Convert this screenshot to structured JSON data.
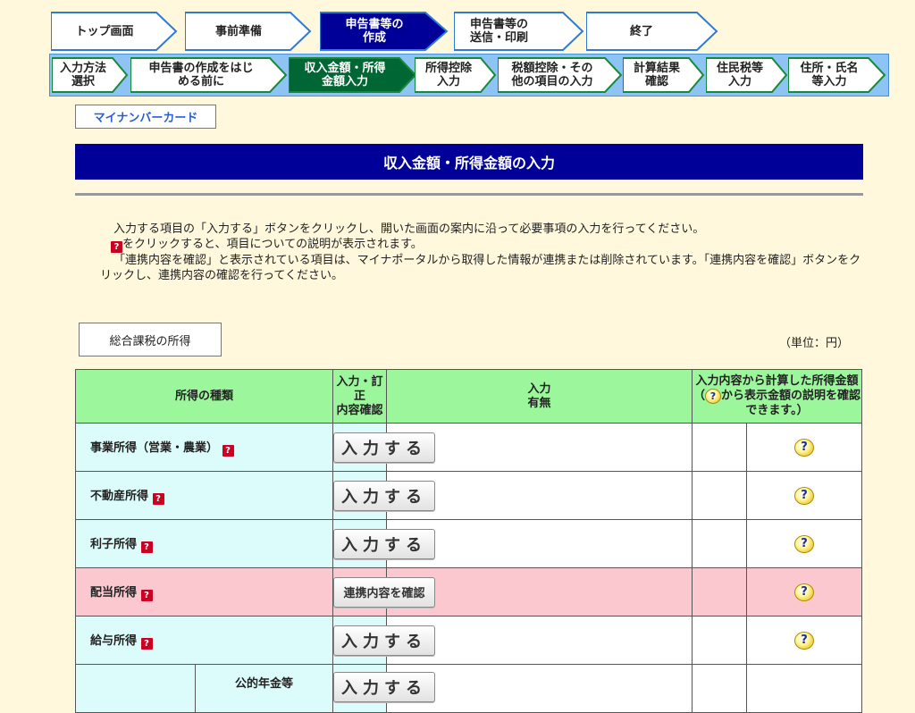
{
  "steps_top": [
    {
      "label": "トップ画面",
      "active": false
    },
    {
      "label": "事前準備",
      "active": false
    },
    {
      "label": "申告書等の\n作成",
      "active": true
    },
    {
      "label": "申告書等の\n送信・印刷",
      "active": false
    },
    {
      "label": "終了",
      "active": false
    }
  ],
  "steps_sub": [
    {
      "label": "入力方法\n選択",
      "active": false
    },
    {
      "label": "申告書の作成をはじ\nめる前に",
      "active": false
    },
    {
      "label": "収入金額・所得\n金額入力",
      "active": true
    },
    {
      "label": "所得控除\n入力",
      "active": false
    },
    {
      "label": "税額控除・その\n他の項目の入力",
      "active": false
    },
    {
      "label": "計算結果\n確認",
      "active": false
    },
    {
      "label": "住民税等\n入力",
      "active": false
    },
    {
      "label": "住所・氏名\n等入力",
      "active": false
    }
  ],
  "mynumber_tab": "マイナンバーカード",
  "page_title": "収入金額・所得金額の入力",
  "instructions": {
    "line1": "入力する項目の「入力する」ボタンをクリックし、開いた画面の案内に沿って必要事項の入力を行ってください。",
    "qmark_symbol": "?",
    "line2": "をクリックすると、項目についての説明が表示されます。",
    "line3": "「連携内容を確認」と表示されている項目は、マイナポータルから取得した情報が連携または削除されています。「連携内容を確認」ボタンをクリックし、連携内容の確認を行ってください。"
  },
  "section_tab": "総合課税の所得",
  "unit_label": "（単位：円）",
  "table": {
    "headers": {
      "type": "所得の種類",
      "input": "入力・訂正\n内容確認",
      "has": "入力\n有無",
      "amount_line1": "入力内容から計算した所得金額",
      "amount_line2_pre": "（",
      "amount_line2_post": "から表示金額の説明を確認できます。）"
    },
    "rows": [
      {
        "name": "事業所得（営業・農業）",
        "button": "入力する",
        "pink": false
      },
      {
        "name": "不動産所得",
        "button": "入力する",
        "pink": false
      },
      {
        "name": "利子所得",
        "button": "入力する",
        "pink": false
      },
      {
        "name": "配当所得",
        "button": "連携内容を確認",
        "pink": true
      },
      {
        "name": "給与所得",
        "button": "入力する",
        "pink": false
      }
    ],
    "partial_row": {
      "sub_name": "公的年金等",
      "button": "入力する"
    },
    "help_symbol": "?"
  },
  "colors": {
    "page_bg": "#fff8dc",
    "title_bg": "#000099",
    "header_green": "#9cf79c",
    "row_cyan": "#dcfcfc",
    "row_pink": "#fcc8d0",
    "step_active": "#000099",
    "sub_active": "#006633"
  }
}
